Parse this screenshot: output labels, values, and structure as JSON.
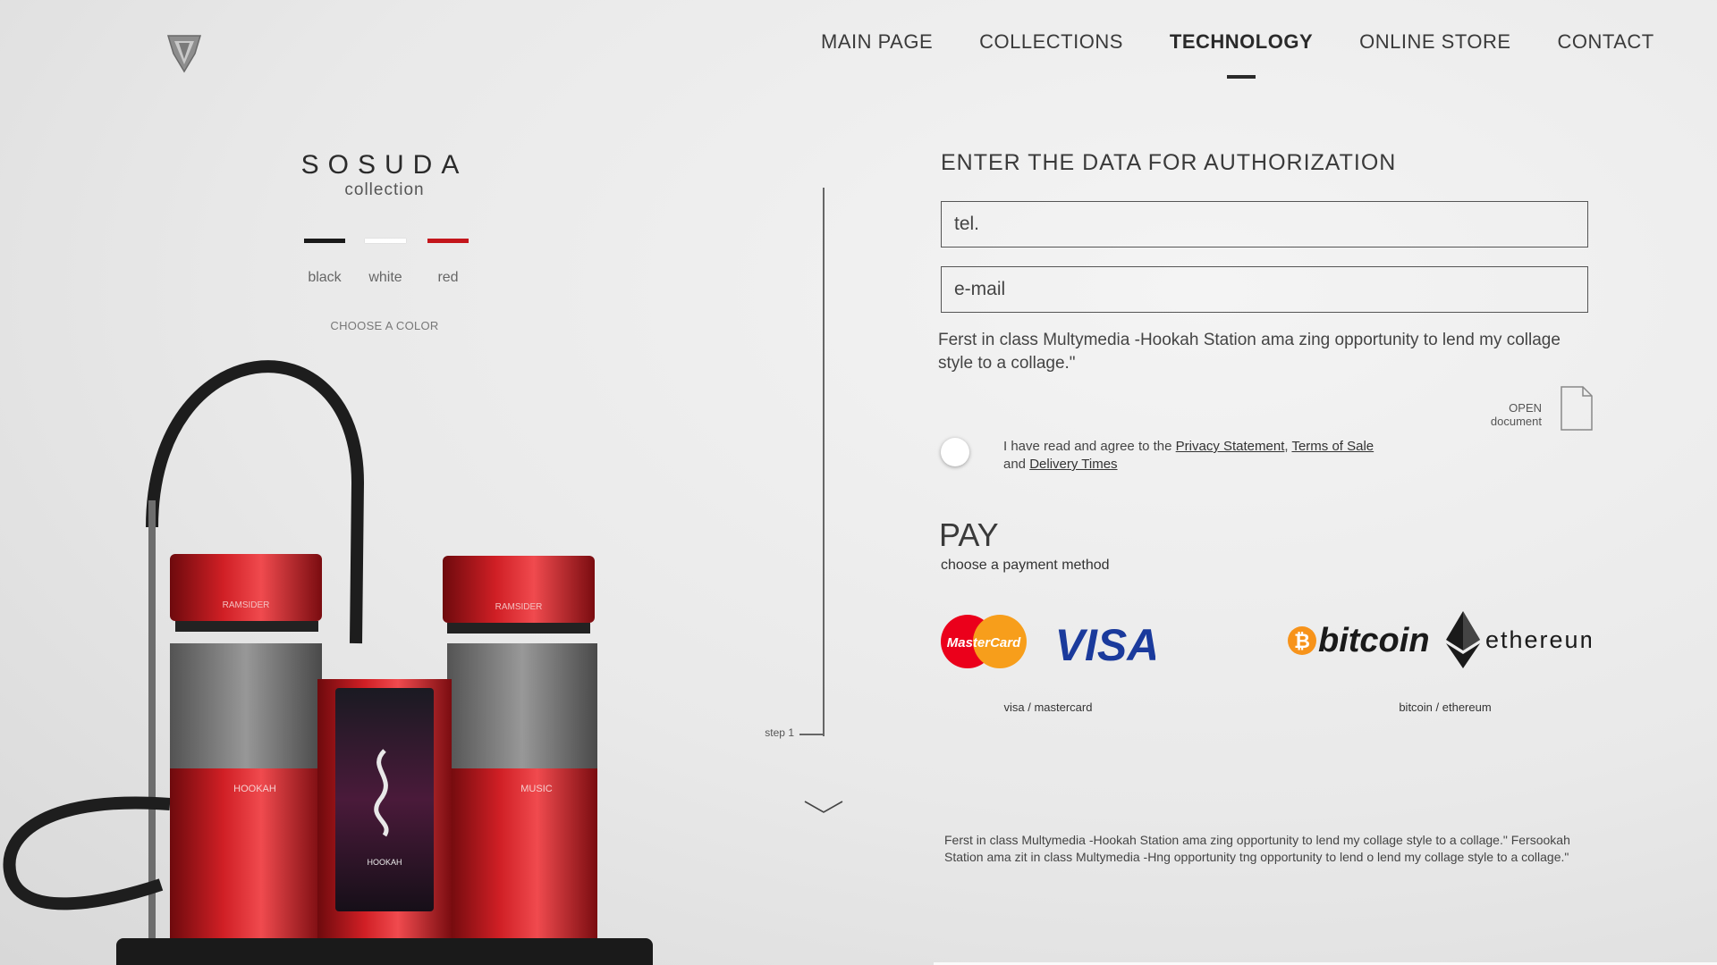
{
  "nav": {
    "items": [
      {
        "label": "MAIN PAGE",
        "active": false
      },
      {
        "label": "COLLECTIONS",
        "active": false
      },
      {
        "label": "TECHNOLOGY",
        "active": true
      },
      {
        "label": "ONLINE STORE",
        "active": false
      },
      {
        "label": "CONTACT",
        "active": false
      }
    ]
  },
  "collection": {
    "name": "SOSUDA",
    "sub": "collection",
    "colors": [
      {
        "label": "black",
        "hex": "#1a1a1a"
      },
      {
        "label": "white",
        "hex": "#ffffff"
      },
      {
        "label": "red",
        "hex": "#c4161c"
      }
    ],
    "choose_label": "CHOOSE A COLOR"
  },
  "product": {
    "panel_brand": "RAMSIDER",
    "panel_title": "HOOKAH",
    "left_tank": "HOOKAH",
    "right_tank": "MUSIC"
  },
  "steps": {
    "label": "step 1"
  },
  "auth": {
    "title": "ENTER THE DATA FOR AUTHORIZATION",
    "tel_placeholder": "tel.",
    "email_placeholder": "e-mail",
    "description": "Ferst in class Multymedia -Hookah Station ama zing opportunity to lend my  collage style to a collage.\"",
    "open_doc_line1": "OPEN",
    "open_doc_line2": "document"
  },
  "agreement": {
    "prefix": "I have read and agree to the ",
    "privacy": "Privacy Statement",
    "comma": ", ",
    "terms": "Terms of Sale",
    "and": "and ",
    "delivery": "Delivery Times"
  },
  "pay": {
    "title": "PAY",
    "subtitle": "choose a payment method",
    "mastercard_text": "MasterCard",
    "visa_text": "VISA",
    "bitcoin_text": "bitcoin",
    "ethereum_text": "ethereum",
    "card_label": "visa / mastercard",
    "crypto_label": "bitcoin / ethereum"
  },
  "bottom": {
    "text": "Ferst in class Multymedia -Hookah Station ama zing opportunity to lend my  collage  style to a collage.\" Fersookah Station ama zit in class Multymedia -Hng opportunity tng opportunity to lend o lend my  collage style to a collage.\""
  },
  "colors": {
    "accent_red": "#c4161c",
    "text_dark": "#333333"
  }
}
